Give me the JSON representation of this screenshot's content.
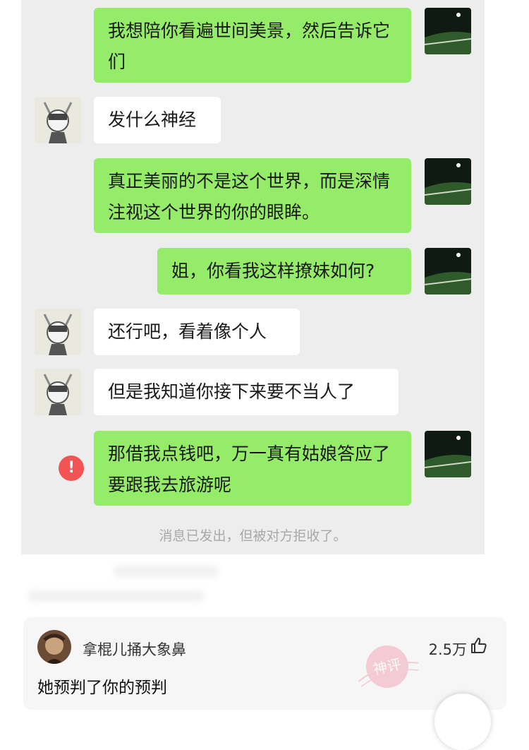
{
  "chat": {
    "messages": [
      {
        "side": "me",
        "text": "我想陪你看遍世间美景，然后告诉它们"
      },
      {
        "side": "other",
        "text": "发什么神经"
      },
      {
        "side": "me",
        "text": "真正美丽的不是这个世界，而是深情注视这个世界的你的眼眸。"
      },
      {
        "side": "me",
        "text": "姐，你看我这样撩妹如何?"
      },
      {
        "side": "other",
        "text": "还行吧，看着像个人"
      },
      {
        "side": "other",
        "text": "但是我知道你接下来要不当人了"
      },
      {
        "side": "me",
        "text": "那借我点钱吧，万一真有姑娘答应了要跟我去旅游呢",
        "failed": true
      }
    ],
    "system_notice": "消息已发出，但被对方拒收了。",
    "error_icon": "!"
  },
  "comment": {
    "username": "拿棍儿捅大象鼻",
    "likes": "2.5万",
    "text": "她预判了你的预判",
    "stamp_text": "神评"
  },
  "colors": {
    "bubble_me": "#95ec69",
    "bubble_other": "#ffffff",
    "chat_bg": "#ededed",
    "error": "#f25454"
  }
}
